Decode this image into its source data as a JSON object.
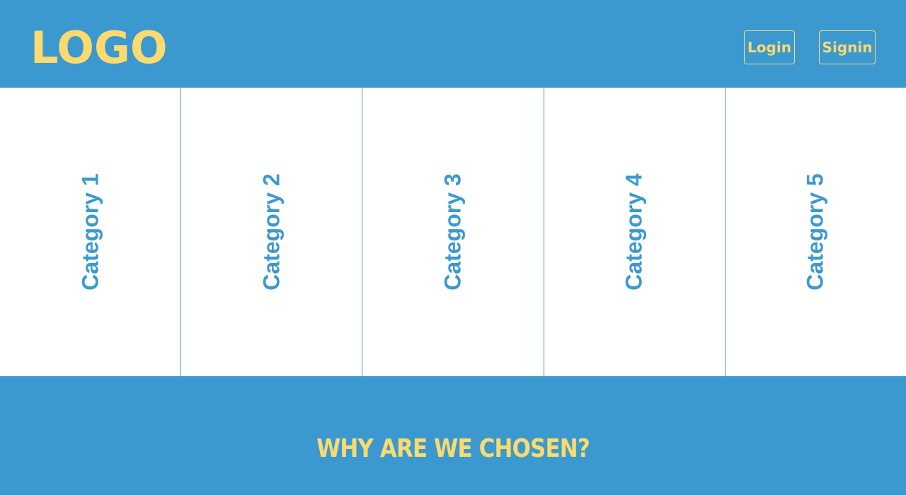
{
  "header": {
    "logo": "LOGO",
    "login_label": "Login",
    "signin_label": "Signin"
  },
  "categories": [
    {
      "label": "Category 1"
    },
    {
      "label": "Category 2"
    },
    {
      "label": "Category 3"
    },
    {
      "label": "Category 4"
    },
    {
      "label": "Category 5"
    }
  ],
  "why_section": {
    "title": "WHY ARE WE CHOSEN?"
  },
  "colors": {
    "primary": "#3c99d0",
    "accent": "#fcda6e",
    "background": "#ffffff"
  }
}
